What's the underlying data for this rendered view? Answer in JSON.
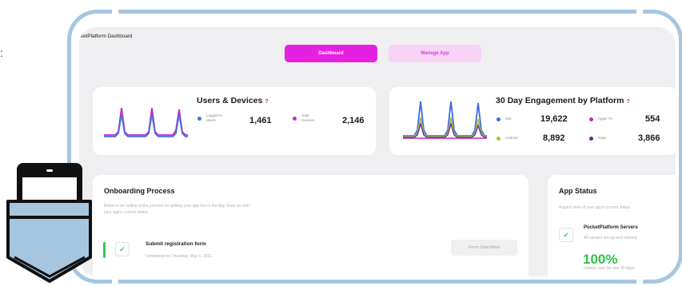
{
  "stray_char": ":",
  "app": {
    "title": "ketPlatform Dashboard"
  },
  "tabs": [
    {
      "label": "Dashboard",
      "active": true
    },
    {
      "label": "Manage App",
      "active": false
    }
  ],
  "users_devices": {
    "title": "Users & Devices",
    "help": "?",
    "stats": [
      {
        "label_line1": "Logged In",
        "label_line2": "Users",
        "value": "1,461",
        "color": "#4a6fe0"
      },
      {
        "label_line1": "Total",
        "label_line2": "Devices",
        "value": "2,146",
        "color": "#c02ac4"
      }
    ]
  },
  "engagement": {
    "title": "30 Day Engagement by Platform",
    "help": "?",
    "platforms": [
      {
        "label": "iOS",
        "value": "19,622",
        "color": "#3b6ce3"
      },
      {
        "label": "Apple TV",
        "value": "554",
        "color": "#c02ac4"
      },
      {
        "label": "Android",
        "value": "8,892",
        "color": "#a9c43a"
      },
      {
        "label": "Roku",
        "value": "3,866",
        "color": "#6b2a8c"
      }
    ]
  },
  "onboarding": {
    "title": "Onboarding Process",
    "description_line1": "Below is an outline of the process for getting your app live in the App Store as well",
    "description_line2": "your app's current status.",
    "steps": [
      {
        "title": "Submit registration form",
        "subtitle": "Completed on Thursday, May 6, 2021",
        "status_label": "Form Submitted",
        "done": true
      }
    ]
  },
  "app_status": {
    "title": "App Status",
    "description": "A quick view of your app's current status",
    "server_title": "PocketPlatform Servers",
    "server_subtitle": "All servers are up and running.",
    "uptime_value": "100%",
    "uptime_label": "Uptime over the last 30 days"
  },
  "colors": {
    "accent": "#e520e1",
    "frame": "#a6c6e0",
    "success": "#2fc449"
  }
}
